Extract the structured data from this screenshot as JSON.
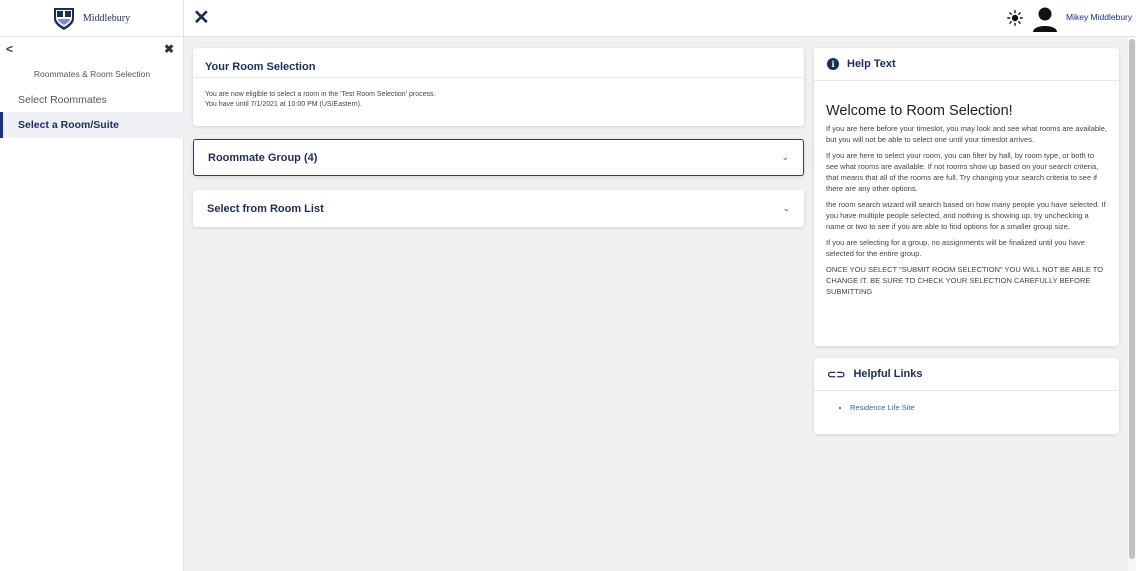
{
  "header": {
    "brand_name": "Middlebury",
    "user_name": "Mikey Middlebury"
  },
  "sidebar": {
    "heading": "Roommates & Room Selection",
    "items": [
      {
        "label": "Select Roommates",
        "active": false
      },
      {
        "label": "Select a Room/Suite",
        "active": true
      }
    ]
  },
  "room_selection": {
    "title": "Your Room Selection",
    "line1": "You are now eligible to select a room in the 'Test Room Selection' process.",
    "line2": "You have until 7/1/2021 at 10:00 PM (US/Eastern)."
  },
  "accordions": [
    {
      "label": "Roommate Group (4)"
    },
    {
      "label": "Select from Room List"
    }
  ],
  "help": {
    "title": "Help Text",
    "welcome": "Welcome to Room Selection!",
    "paragraphs": [
      "If you are here before your timeslot, you may look and see what rooms are available, but you will not be able to select one until your timeslot arrives.",
      "If you are here to select your room, you can filter by hall, by room type, or both to see what rooms are available. If not rooms show up based on your search criteria, that means that all of the rooms are full. Try changing your search criteria to see if there are any other options.",
      "the room search wizard will search based on how many people you have selected. If you have multiple people selected, and nothing is showing up, try unchecking a name or two to see if you are able to find options for a smaller group size.",
      "If you are selecting for a group, no assignments will be finalized until you have selected for the entire group.",
      "ONCE YOU SELECT \"SUBMIT ROOM SELECTION\" YOU WILL NOT BE ABLE TO CHANGE IT. BE SURE TO CHECK YOUR SELECTION CAREFULLY BEFORE SUBMITTING"
    ]
  },
  "links": {
    "title": "Helpful Links",
    "items": [
      "Residence Life Site"
    ]
  },
  "colors": {
    "brand_navy": "#1c2d5a",
    "link_blue": "#2a6bb0",
    "active_bg": "#eef0f6"
  }
}
